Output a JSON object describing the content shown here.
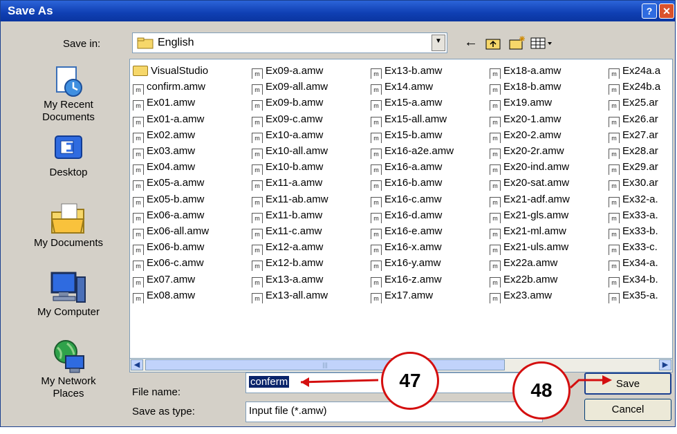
{
  "window": {
    "title": "Save As",
    "help_glyph": "?",
    "close_glyph": "✕"
  },
  "save_in": {
    "label": "Save in:",
    "value": "English"
  },
  "toolbar": {
    "icons": [
      "back-arrow-icon",
      "up-folder-icon",
      "new-folder-icon",
      "views-menu-icon"
    ]
  },
  "places": [
    {
      "name": "recent",
      "label1": "My Recent",
      "label2": "Documents"
    },
    {
      "name": "desktop",
      "label1": "Desktop",
      "label2": ""
    },
    {
      "name": "documents",
      "label1": "My Documents",
      "label2": ""
    },
    {
      "name": "computer",
      "label1": "My Computer",
      "label2": ""
    },
    {
      "name": "network",
      "label1": "My Network",
      "label2": "Places"
    }
  ],
  "files": [
    [
      "VisualStudio",
      "confirm.amw",
      "Ex01.amw",
      "Ex01-a.amw",
      "Ex02.amw",
      "Ex03.amw",
      "Ex04.amw",
      "Ex05-a.amw",
      "Ex05-b.amw",
      "Ex06-a.amw",
      "Ex06-all.amw",
      "Ex06-b.amw",
      "Ex06-c.amw",
      "Ex07.amw",
      "Ex08.amw"
    ],
    [
      "Ex09-a.amw",
      "Ex09-all.amw",
      "Ex09-b.amw",
      "Ex09-c.amw",
      "Ex10-a.amw",
      "Ex10-all.amw",
      "Ex10-b.amw",
      "Ex11-a.amw",
      "Ex11-ab.amw",
      "Ex11-b.amw",
      "Ex11-c.amw",
      "Ex12-a.amw",
      "Ex12-b.amw",
      "Ex13-a.amw",
      "Ex13-all.amw"
    ],
    [
      "Ex13-b.amw",
      "Ex14.amw",
      "Ex15-a.amw",
      "Ex15-all.amw",
      "Ex15-b.amw",
      "Ex16-a2e.amw",
      "Ex16-a.amw",
      "Ex16-b.amw",
      "Ex16-c.amw",
      "Ex16-d.amw",
      "Ex16-e.amw",
      "Ex16-x.amw",
      "Ex16-y.amw",
      "Ex16-z.amw",
      "Ex17.amw"
    ],
    [
      "Ex18-a.amw",
      "Ex18-b.amw",
      "Ex19.amw",
      "Ex20-1.amw",
      "Ex20-2.amw",
      "Ex20-2r.amw",
      "Ex20-ind.amw",
      "Ex20-sat.amw",
      "Ex21-adf.amw",
      "Ex21-gls.amw",
      "Ex21-ml.amw",
      "Ex21-uls.amw",
      "Ex22a.amw",
      "Ex22b.amw",
      "Ex23.amw"
    ],
    [
      "Ex24a.a",
      "Ex24b.a",
      "Ex25.ar",
      "Ex26.ar",
      "Ex27.ar",
      "Ex28.ar",
      "Ex29.ar",
      "Ex30.ar",
      "Ex32-a.",
      "Ex33-a.",
      "Ex33-b.",
      "Ex33-c.",
      "Ex34-a.",
      "Ex34-b.",
      "Ex35-a."
    ]
  ],
  "file_name": {
    "label": "File name:",
    "value": "conferm"
  },
  "save_type": {
    "label": "Save as type:",
    "value": "Input file (*.amw)"
  },
  "buttons": {
    "save": "Save",
    "cancel": "Cancel"
  },
  "callouts": {
    "first": "47",
    "second": "48"
  },
  "colors": {
    "callout_border": "#d40f0f",
    "titlebar": "#0f3fb3",
    "selection": "#0a246a"
  }
}
